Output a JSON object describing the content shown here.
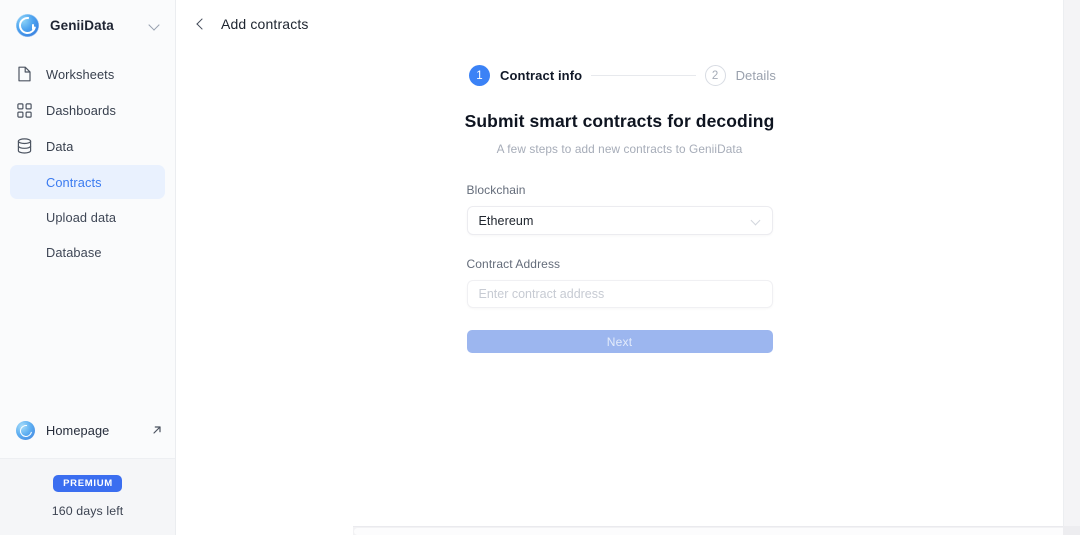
{
  "sidebar": {
    "brand": {
      "name": "GeniiData",
      "logo_icon": "geniidata-logo-icon",
      "chevron_icon": "chevron-down-icon"
    },
    "nav": [
      {
        "label": "Worksheets",
        "icon": "document-icon"
      },
      {
        "label": "Dashboards",
        "icon": "grid-icon"
      },
      {
        "label": "Data",
        "icon": "database-icon"
      }
    ],
    "sub_items": [
      {
        "label": "Contracts",
        "active": true
      },
      {
        "label": "Upload data",
        "active": false
      },
      {
        "label": "Database",
        "active": false
      }
    ],
    "homepage": {
      "label": "Homepage",
      "logo_icon": "geniidata-logo-icon",
      "external_icon": "external-link-arrow-icon"
    },
    "premium": {
      "badge": "PREMIUM",
      "days_left": "160 days left",
      "badge_color": "#3b6ef0"
    }
  },
  "topbar": {
    "back_icon": "chevron-left-icon",
    "title": "Add contracts"
  },
  "stepper": {
    "steps": [
      {
        "number": "1",
        "label": "Contract info",
        "state": "active"
      },
      {
        "number": "2",
        "label": "Details",
        "state": "inactive"
      }
    ],
    "active_color": "#3b82f6",
    "inactive_color": "#9aa1ad"
  },
  "main": {
    "headline": "Submit smart contracts for decoding",
    "subhead": "A few steps to add new contracts to GeniiData",
    "form": {
      "blockchain": {
        "label": "Blockchain",
        "value": "Ethereum",
        "caret_icon": "chevron-down-icon"
      },
      "contract_address": {
        "label": "Contract Address",
        "value": "",
        "placeholder": "Enter contract address"
      },
      "submit": {
        "label": "Next",
        "disabled": true,
        "color": "#9cb6ef"
      }
    }
  }
}
